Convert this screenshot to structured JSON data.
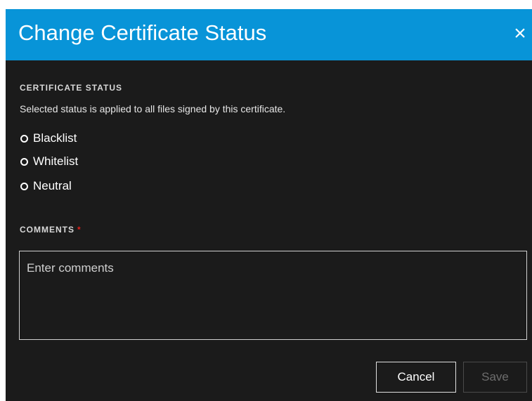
{
  "dialog": {
    "title": "Change Certificate Status",
    "close_label": "×",
    "header_color": "#0894d8",
    "background_color": "#1b1b1b"
  },
  "certificate_status": {
    "label": "CERTIFICATE STATUS",
    "description": "Selected status is applied to all files signed by this certificate.",
    "options": [
      {
        "label": "Blacklist",
        "selected": false
      },
      {
        "label": "Whitelist",
        "selected": false
      },
      {
        "label": "Neutral",
        "selected": false
      }
    ]
  },
  "comments": {
    "label": "COMMENTS",
    "required_marker": "*",
    "required_color": "#e0211c",
    "placeholder": "Enter comments",
    "value": ""
  },
  "buttons": {
    "cancel_label": "Cancel",
    "save_label": "Save",
    "save_enabled": false
  },
  "icons": {
    "close": "close-icon",
    "radio": "radio-unselected-icon"
  }
}
